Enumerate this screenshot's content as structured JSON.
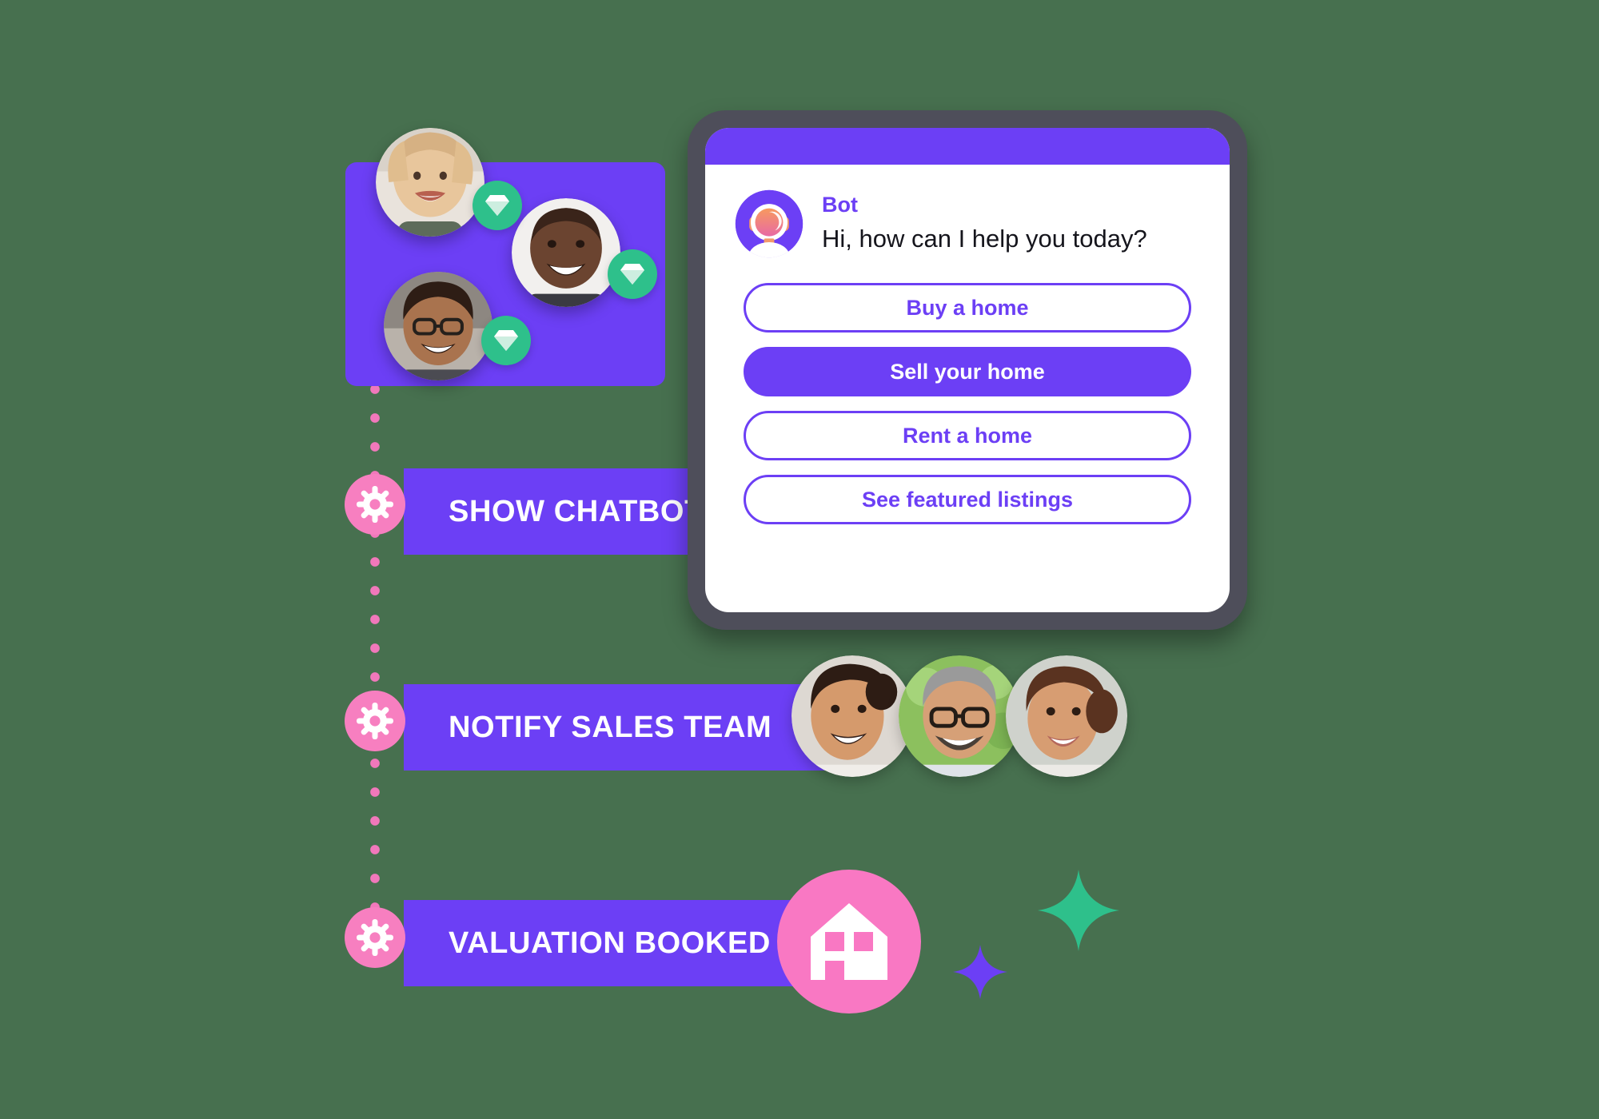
{
  "background_color": "#47704f",
  "brand": {
    "purple": "#6c3ff5",
    "pink": "#f77fc0",
    "hot_pink": "#f978c3",
    "green": "#2ec08b",
    "device_frame": "#4e4e5a"
  },
  "chat_device": {
    "topbar_color": "#6c3ff5",
    "bot": {
      "avatar_icon": "bot-headset-avatar-icon",
      "name": "Bot",
      "message": "Hi, how can I help you today?"
    },
    "choices": [
      {
        "label": "Buy a home",
        "style": "outline"
      },
      {
        "label": "Sell your home",
        "style": "filled"
      },
      {
        "label": "Rent a home",
        "style": "outline"
      },
      {
        "label": "See featured listings",
        "style": "outline"
      }
    ]
  },
  "avatar_card": {
    "badge_icon": "gem-diamond-icon",
    "members": [
      {
        "name": "blonde-woman-avatar"
      },
      {
        "name": "smiling-man-avatar"
      },
      {
        "name": "man-with-glasses-avatar"
      }
    ]
  },
  "workflow_steps": [
    {
      "icon": "gear-icon",
      "label": "SHOW CHATBOT"
    },
    {
      "icon": "gear-icon",
      "label": "NOTIFY SALES TEAM"
    },
    {
      "icon": "gear-icon",
      "label": "VALUATION BOOKED"
    }
  ],
  "sales_team": [
    {
      "name": "curly-hair-woman-avatar"
    },
    {
      "name": "bearded-man-glasses-avatar"
    },
    {
      "name": "short-curly-hair-woman-avatar"
    }
  ],
  "valuation_badge": {
    "icon": "house-icon"
  },
  "decorations": [
    {
      "icon": "sparkle-icon",
      "color": "#6c3ff5",
      "size": "small"
    },
    {
      "icon": "sparkle-icon",
      "color": "#2ec08b",
      "size": "large"
    }
  ]
}
